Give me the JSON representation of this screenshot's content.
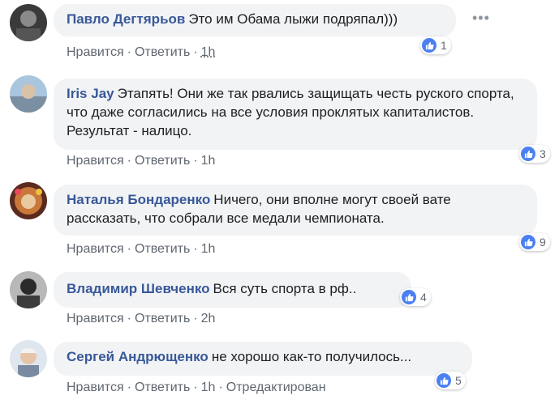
{
  "comments": [
    {
      "author": "Павло Дегтярьов",
      "text": "Это им Обама лыжи подряпал)))",
      "like_count": "1",
      "like_label": "Нравится",
      "reply_label": "Ответить",
      "time": "1h",
      "edited": ""
    },
    {
      "author": "Iris Jay",
      "text": "Этапять! Они же так рвались защищать честь руского спорта, что даже согласились на все условия проклятых капиталистов. Результат - налицо.",
      "like_count": "3",
      "like_label": "Нравится",
      "reply_label": "Ответить",
      "time": "1h",
      "edited": ""
    },
    {
      "author": "Наталья Бондаренко",
      "text": "Ничего, они вполне могут своей вате рассказать, что собрали все медали чемпионата.",
      "like_count": "9",
      "like_label": "Нравится",
      "reply_label": "Ответить",
      "time": "1h",
      "edited": ""
    },
    {
      "author": "Владимир Шевченко",
      "text": "Вся суть спорта в рф..",
      "like_count": "4",
      "like_label": "Нравится",
      "reply_label": "Ответить",
      "time": "2h",
      "edited": ""
    },
    {
      "author": "Сергей Андрющенко",
      "text": "не хорошо как-то получилось...",
      "like_count": "5",
      "like_label": "Нравится",
      "reply_label": "Ответить",
      "time": "1h",
      "edited": "Отредактирован"
    }
  ],
  "icons": {
    "like": "thumbs-up-icon",
    "more": "more-options-icon"
  },
  "colors": {
    "author": "#385898",
    "bubble": "#f2f3f5",
    "like_badge": "#4b80f2",
    "meta": "#606770"
  }
}
